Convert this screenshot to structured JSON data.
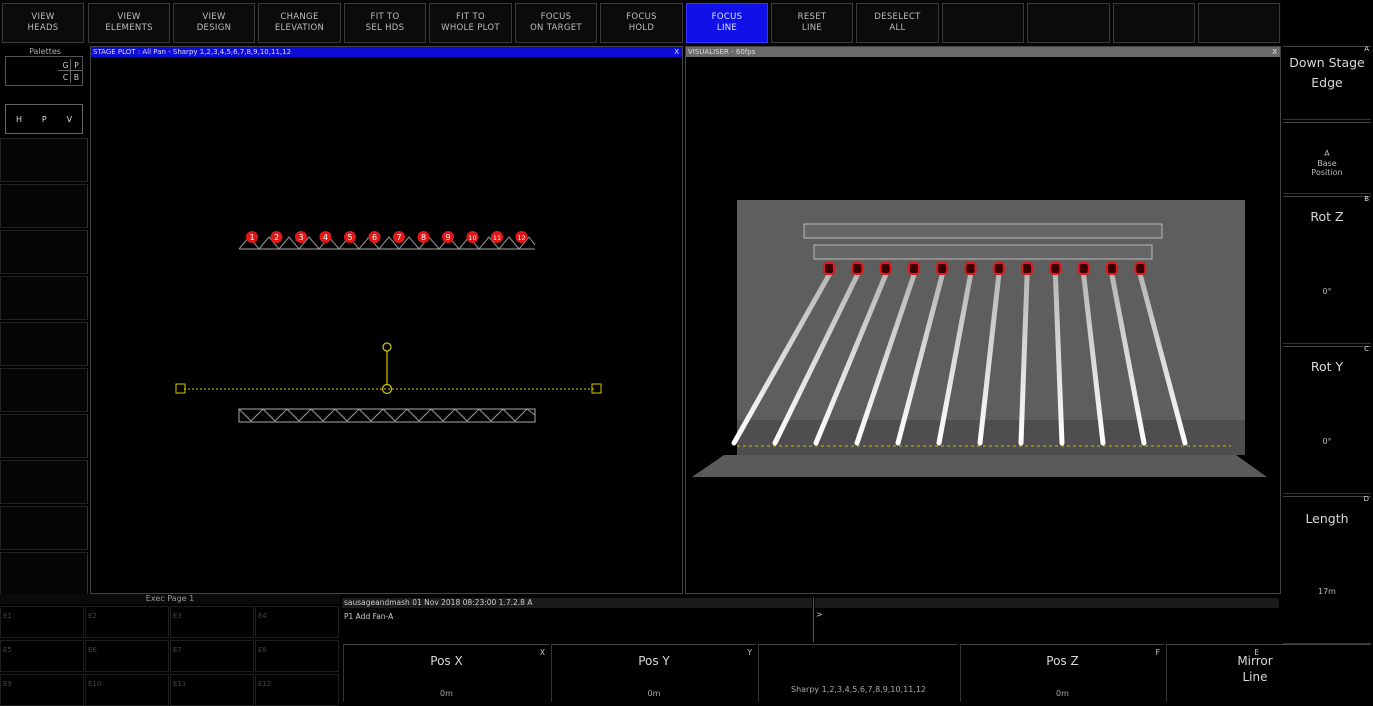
{
  "toolbar": {
    "buttons": [
      {
        "label": "VIEW\nHEADS"
      },
      {
        "label": "VIEW\nELEMENTS"
      },
      {
        "label": "VIEW\nDESIGN"
      },
      {
        "label": "CHANGE\nELEVATION"
      },
      {
        "label": "FIT TO\nSEL HDS"
      },
      {
        "label": "FIT TO\nWHOLE PLOT"
      },
      {
        "label": "FOCUS\nON TARGET"
      },
      {
        "label": "FOCUS\nHOLD"
      },
      {
        "label": "FOCUS\nLINE"
      },
      {
        "label": "RESET\nLINE"
      },
      {
        "label": "DESELECT\nALL"
      }
    ]
  },
  "palettes": {
    "title": "Palettes",
    "cells": [
      "G",
      "P",
      "C",
      "B"
    ],
    "hpv": [
      "H",
      "P",
      "V"
    ]
  },
  "stage_plot": {
    "title": "STAGE PLOT : All Pan - Sharpy 1,2,3,4,5,6,7,8,9,10,11,12",
    "close": "X",
    "fixtures": [
      "1",
      "2",
      "3",
      "4",
      "5",
      "6",
      "7",
      "8",
      "9",
      "10",
      "11",
      "12"
    ]
  },
  "visualiser": {
    "title": "VISUALISER - 60fps",
    "close": "X"
  },
  "right_panel": {
    "buttons": [
      {
        "label": "Down Stage\nEdge",
        "key": "A"
      },
      {
        "label": "Base\nPosition",
        "key": "",
        "small_label": "A"
      },
      {
        "label": "Rot Z",
        "key": "B",
        "value": "0°"
      },
      {
        "label": "Rot Y",
        "key": "C",
        "value": "0°"
      },
      {
        "label": "Length",
        "key": "D",
        "value": "17m"
      }
    ]
  },
  "exec": {
    "title": "Exec Page 1",
    "cells": [
      "E1",
      "E2",
      "E3",
      "E4",
      "E5",
      "E6",
      "E7",
      "E8",
      "E9",
      "E10",
      "E11",
      "E12"
    ]
  },
  "command": {
    "header": "sausageandmash 01 Nov 2018 08:23:00 1.7.2.8  A",
    "line": "P1 Add Fan-A",
    "prompt": ">"
  },
  "bottom": {
    "buttons": [
      {
        "label": "Pos X",
        "key": "X",
        "value": "0m"
      },
      {
        "label": "Pos Y",
        "key": "Y",
        "value": "0m"
      },
      {
        "label": "",
        "key": "",
        "value": "Sharpy 1,2,3,4,5,6,7,8,9,10,11,12"
      },
      {
        "label": "Pos Z",
        "key": "F",
        "value": "0m"
      },
      {
        "label": "Mirror\nLine",
        "key": "E",
        "value": ""
      }
    ]
  },
  "colors": {
    "active": "#1010e8",
    "fixture": "#e01818",
    "focus_line": "#d8c800"
  }
}
